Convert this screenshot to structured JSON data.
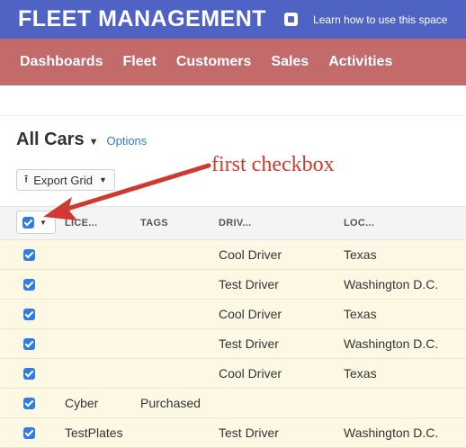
{
  "header": {
    "app_title": "FLEET MANAGEMENT",
    "help_link": "Learn how to use this space",
    "icon": "external-link-icon",
    "colors": {
      "topbar": "#4f63c5",
      "navbar": "#c36a6a"
    }
  },
  "nav": {
    "items": [
      "Dashboards",
      "Fleet",
      "Customers",
      "Sales",
      "Activities"
    ]
  },
  "view": {
    "title": "All Cars",
    "options_label": "Options",
    "export_label": "Export Grid"
  },
  "annotation": {
    "text": "first checkbox",
    "color": "#d0392f"
  },
  "grid": {
    "columns": [
      "LICE...",
      "TAGS",
      "DRIV...",
      "LOC..."
    ],
    "rows": [
      {
        "checked": true,
        "license": "",
        "tags": "",
        "driver": "Cool Driver",
        "location": "Texas"
      },
      {
        "checked": true,
        "license": "",
        "tags": "",
        "driver": "Test Driver",
        "location": "Washington D.C."
      },
      {
        "checked": true,
        "license": "",
        "tags": "",
        "driver": "Cool Driver",
        "location": "Texas"
      },
      {
        "checked": true,
        "license": "",
        "tags": "",
        "driver": "Test Driver",
        "location": "Washington D.C."
      },
      {
        "checked": true,
        "license": "",
        "tags": "",
        "driver": "Cool Driver",
        "location": "Texas"
      },
      {
        "checked": true,
        "license": "Cyber",
        "tags": "Purchased",
        "driver": "",
        "location": ""
      },
      {
        "checked": true,
        "license": "TestPlates",
        "tags": "",
        "driver": "Test Driver",
        "location": "Washington D.C."
      }
    ],
    "row_color": "#fdf8e4",
    "checkbox_color": "#2f7de1"
  }
}
